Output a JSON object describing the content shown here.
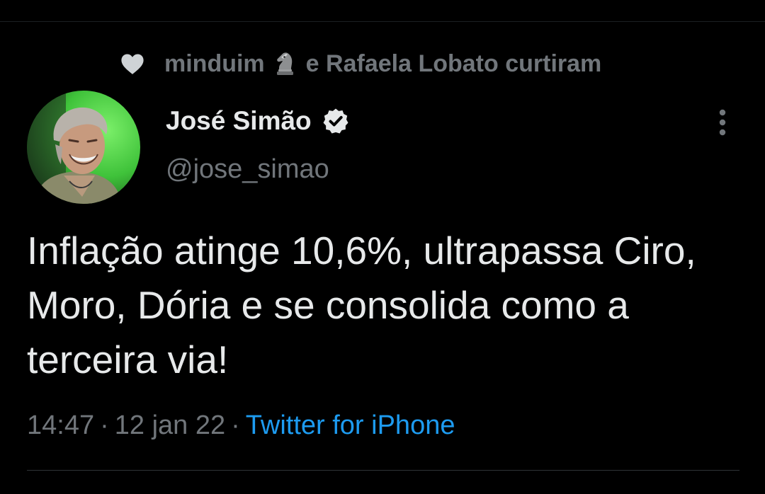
{
  "social_context": {
    "user1": "minduim",
    "connector": "e",
    "user2": "Rafaela Lobato",
    "verb": "curtiram",
    "heart_icon": "heart-icon",
    "emoji_icon": "chess-knight-icon"
  },
  "author": {
    "name": "José Simão",
    "handle": "@jose_simao",
    "verified_icon": "verified-badge-icon"
  },
  "tweet": {
    "text": "Inflação atinge 10,6%, ultrapassa Ciro, Moro, Dória e se consolida como a terceira via!",
    "time": "14:47",
    "date": "12 jan 22",
    "source": "Twitter for iPhone",
    "separator": "·"
  },
  "colors": {
    "background": "#000000",
    "text_primary": "#e7e9ea",
    "text_secondary": "#71767b",
    "link": "#1d9bf0"
  }
}
